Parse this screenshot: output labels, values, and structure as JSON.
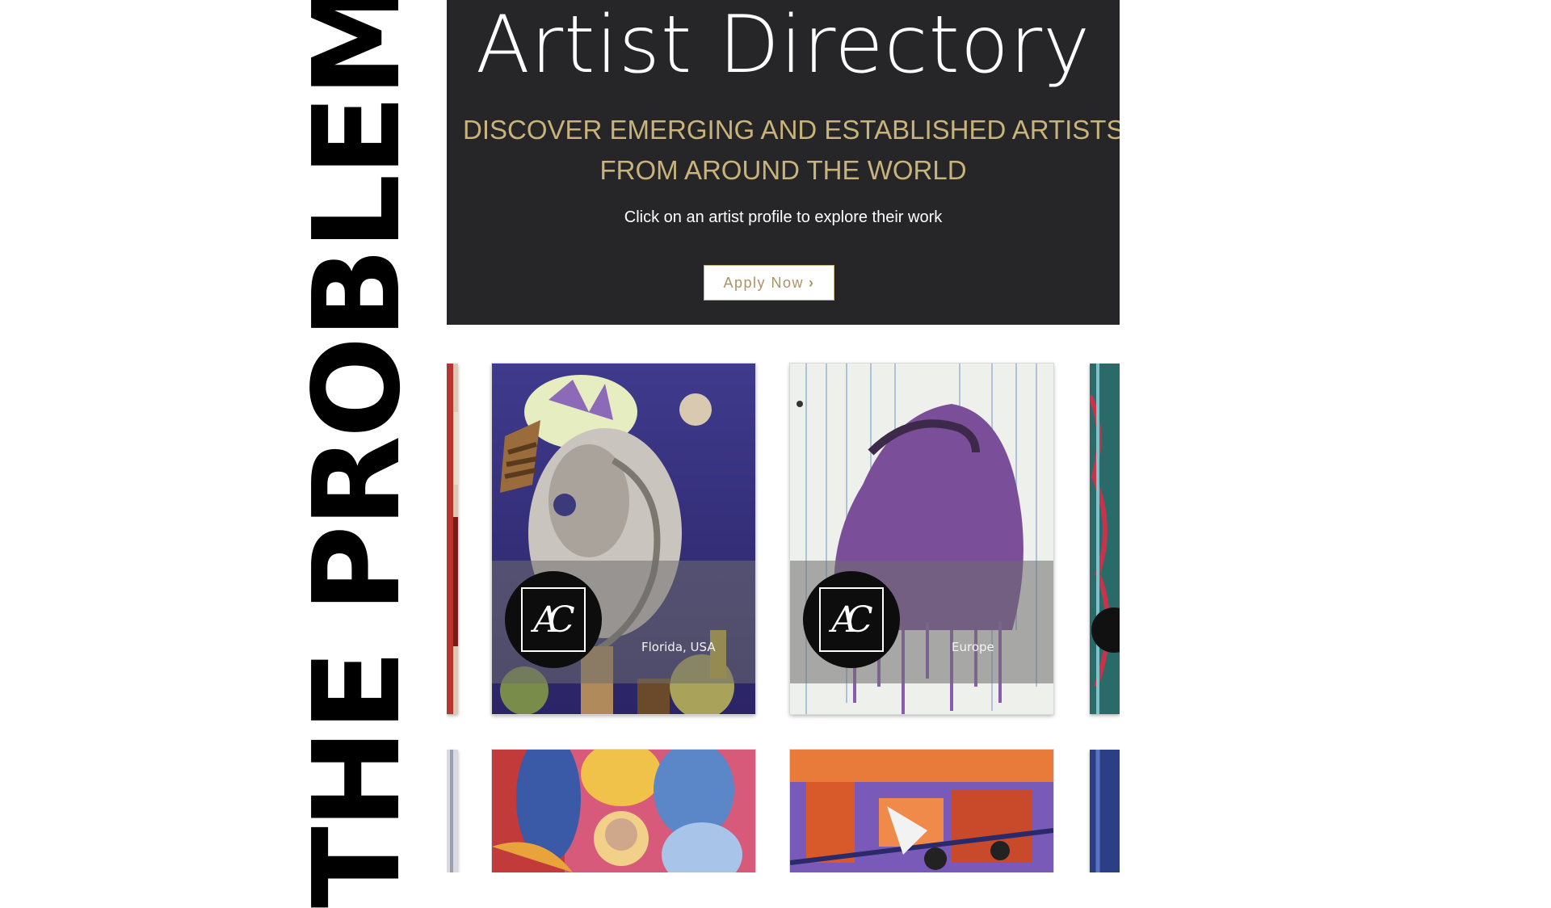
{
  "slide": {
    "heading": "THE PROBLEM"
  },
  "site": {
    "hero": {
      "title": "Artist Directory",
      "subtitle_line1": "DISCOVER EMERGING AND ESTABLISHED ARTISTS",
      "subtitle_line2": "FROM AROUND THE WORLD",
      "note": "Click on an artist profile to explore their work",
      "apply_label": "Apply Now",
      "apply_icon": "chevron-right-icon"
    },
    "cards": [
      {
        "location": "Florida, USA",
        "logo_text": "AC"
      },
      {
        "location": "Europe",
        "logo_text": "AC"
      }
    ]
  },
  "colors": {
    "hero_bg": "#262527",
    "gold": "#c8b37a",
    "button_text": "#a89465"
  }
}
